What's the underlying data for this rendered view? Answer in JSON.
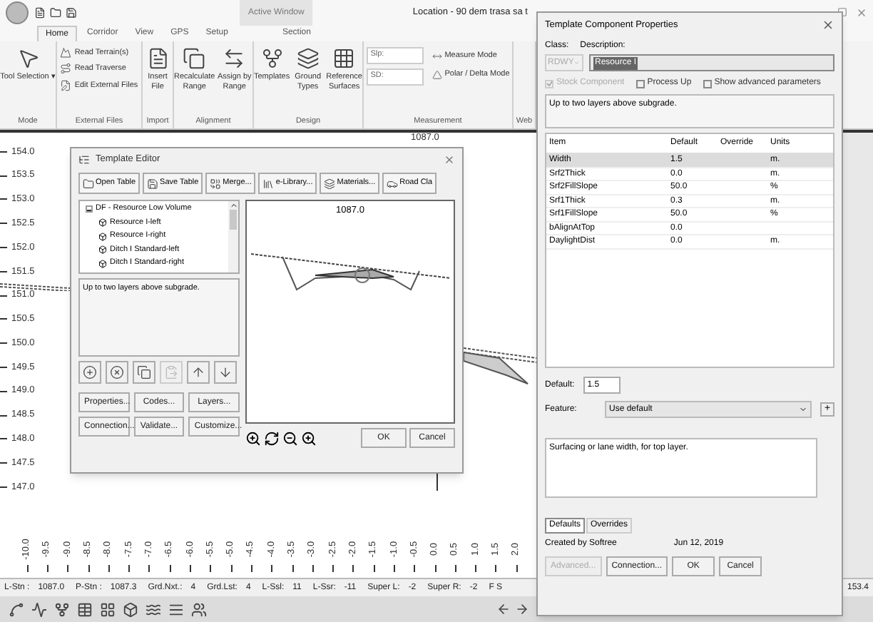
{
  "window": {
    "title": "Location - 90 dem trasa sa t",
    "context_tab": "Active Window"
  },
  "tabs": [
    {
      "label": "Home",
      "selected": true
    },
    {
      "label": "Corridor",
      "selected": false
    },
    {
      "label": "View",
      "selected": false
    },
    {
      "label": "GPS",
      "selected": false
    },
    {
      "label": "Setup",
      "selected": false
    },
    {
      "label": "Section",
      "selected": false
    }
  ],
  "ribbon": {
    "groups": [
      {
        "label": "Mode",
        "kind": "large",
        "items": [
          {
            "label": "Tool Selection ▾"
          }
        ]
      },
      {
        "label": "External Files",
        "kind": "small",
        "items": [
          {
            "label": "Read Terrain(s)"
          },
          {
            "label": "Read Traverse"
          },
          {
            "label": "Edit External Files"
          }
        ]
      },
      {
        "label": "Import",
        "kind": "large",
        "items": [
          {
            "label": "Insert File"
          }
        ]
      },
      {
        "label": "Alignment",
        "kind": "large",
        "items": [
          {
            "label": "Recalculate Range"
          },
          {
            "label": "Assign by Range"
          }
        ]
      },
      {
        "label": "Design",
        "kind": "large",
        "items": [
          {
            "label": "Templates"
          },
          {
            "label": "Ground Types"
          },
          {
            "label": "Reference Surfaces"
          }
        ]
      },
      {
        "label": "Measurement",
        "kind": "measure",
        "fields": [
          {
            "label": "Slp:"
          },
          {
            "label": "SD:"
          }
        ],
        "items": [
          {
            "label": "Measure Mode"
          },
          {
            "label": "Polar / Delta Mode"
          }
        ]
      },
      {
        "label": "Web",
        "kind": "large"
      }
    ]
  },
  "canvas": {
    "station": "1087.0",
    "y_labels": [
      "154.0",
      "153.5",
      "153.0",
      "152.5",
      "152.0",
      "151.5",
      "151.0",
      "150.5",
      "150.0",
      "149.5",
      "149.0",
      "148.5",
      "148.0",
      "147.5",
      "147.0"
    ],
    "x_labels": [
      "-10.0",
      "-9.5",
      "-9.0",
      "-8.5",
      "-8.0",
      "-7.5",
      "-7.0",
      "-6.5",
      "-6.0",
      "-5.5",
      "-5.0",
      "-4.5",
      "-4.0",
      "-3.5",
      "-3.0",
      "-2.5",
      "-2.0",
      "-1.5",
      "-1.0",
      "-0.5",
      "0.0",
      "0.5",
      "1.0",
      "1.5",
      "2.0"
    ]
  },
  "status_bar": {
    "items": [
      {
        "label": "L-Stn :",
        "value": "1087.0"
      },
      {
        "label": "P-Stn :",
        "value": "1087.3"
      },
      {
        "label": "Grd.Nxt.:",
        "value": "4"
      },
      {
        "label": "Grd.Lst:",
        "value": "4"
      },
      {
        "label": "L-Ssl:",
        "value": "11"
      },
      {
        "label": "L-Ssr:",
        "value": "-11"
      },
      {
        "label": "Super L:",
        "value": "-2"
      },
      {
        "label": "Super R:",
        "value": "-2"
      }
    ],
    "tail": "F S",
    "reading": "153.4"
  },
  "template_editor": {
    "title": "Template Editor",
    "toolbar": [
      "Open Table",
      "Save Table",
      "Merge...",
      "e-Library...",
      "Materials...",
      "Road Cla"
    ],
    "tree": [
      {
        "label": "DF - Resource Low Volume",
        "expanded": true,
        "children": [
          {
            "label": "Resource I-left"
          },
          {
            "label": "Resource I-right"
          },
          {
            "label": "Ditch I Standard-left"
          },
          {
            "label": "Ditch I Standard-right"
          }
        ]
      }
    ],
    "description": "Up to two layers above subgrade.",
    "icon_buttons": [
      {
        "disabled": false
      },
      {
        "disabled": false
      },
      {
        "disabled": false
      },
      {
        "disabled": true
      },
      {
        "disabled": false
      },
      {
        "disabled": false
      }
    ],
    "buttons": [
      "Properties...",
      "Codes...",
      "Layers...",
      "Connection...",
      "Validate...",
      "Customize..."
    ],
    "preview_station": "1087.0",
    "ok": "OK",
    "cancel": "Cancel"
  },
  "properties": {
    "title": "Template Component Properties",
    "class_label": "Class:",
    "class_value": "RDWY",
    "description_label": "Description:",
    "description_value": "Resource I",
    "checks": [
      {
        "label": "Stock Component",
        "checked": true,
        "disabled": true
      },
      {
        "label": "Process Up",
        "checked": false,
        "disabled": false
      },
      {
        "label": "Show advanced parameters",
        "checked": false,
        "disabled": false
      }
    ],
    "note": "Up to two layers above subgrade.",
    "columns": [
      "Item",
      "Default",
      "Override",
      "Units"
    ],
    "rows": [
      {
        "item": "Width",
        "default": "1.5",
        "units": "m.",
        "selected": true
      },
      {
        "item": "Srf2Thick",
        "default": "0.0",
        "units": "m.",
        "selected": false
      },
      {
        "item": "Srf2FillSlope",
        "default": "50.0",
        "units": "%",
        "selected": false
      },
      {
        "item": "Srf1Thick",
        "default": "0.3",
        "units": "m.",
        "selected": false
      },
      {
        "item": "Srf1FillSlope",
        "default": "50.0",
        "units": "%",
        "selected": false
      },
      {
        "item": "bAlignAtTop",
        "default": "0.0",
        "selected": false
      },
      {
        "item": "DaylightDist",
        "default": "0.0",
        "units": "m.",
        "selected": false
      }
    ],
    "default_label": "Default:",
    "default_value": "1.5",
    "feature_label": "Feature:",
    "feature_value": "Use default",
    "plus": "+",
    "help": "Surfacing or lane width, for top layer.",
    "tabs": [
      {
        "label": "Defaults",
        "selected": true
      },
      {
        "label": "Overrides",
        "selected": false
      }
    ],
    "created": "Created by Softree",
    "date": "Jun 12, 2019",
    "buttons": [
      {
        "label": "Advanced...",
        "disabled": true
      },
      {
        "label": "Connection...",
        "disabled": false
      },
      {
        "label": "OK",
        "disabled": false
      },
      {
        "label": "Cancel",
        "disabled": false
      }
    ]
  }
}
